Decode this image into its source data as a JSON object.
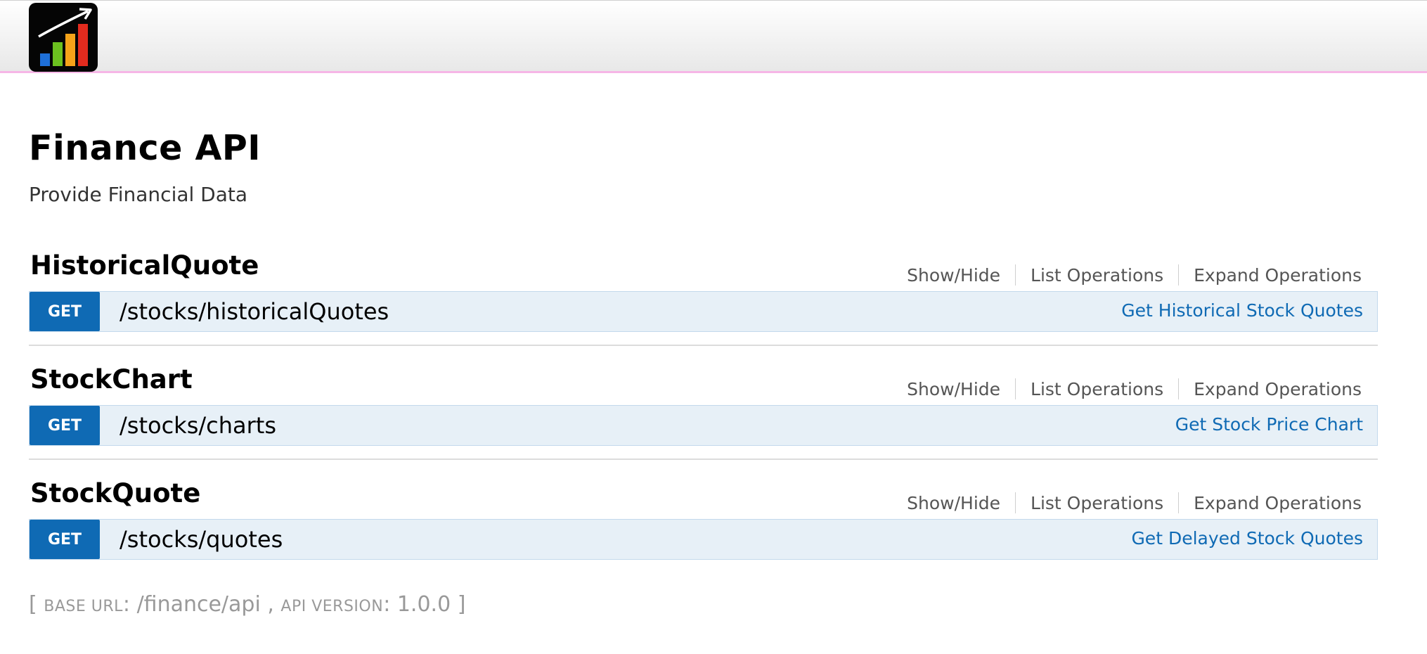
{
  "api": {
    "title": "Finance API",
    "description": "Provide Financial Data"
  },
  "sections": [
    {
      "name": "HistoricalQuote",
      "links": {
        "show_hide": "Show/Hide",
        "list_ops": "List Operations",
        "expand_ops": "Expand Operations"
      },
      "operation": {
        "method": "GET",
        "path": "/stocks/historicalQuotes",
        "summary": "Get Historical Stock Quotes"
      }
    },
    {
      "name": "StockChart",
      "links": {
        "show_hide": "Show/Hide",
        "list_ops": "List Operations",
        "expand_ops": "Expand Operations"
      },
      "operation": {
        "method": "GET",
        "path": "/stocks/charts",
        "summary": "Get Stock Price Chart"
      }
    },
    {
      "name": "StockQuote",
      "links": {
        "show_hide": "Show/Hide",
        "list_ops": "List Operations",
        "expand_ops": "Expand Operations"
      },
      "operation": {
        "method": "GET",
        "path": "/stocks/quotes",
        "summary": "Get Delayed Stock Quotes"
      }
    }
  ],
  "footer": {
    "open": "[ ",
    "base_url_label": "BASE URL",
    "colon1": ": ",
    "base_url": "/finance/api",
    "comma": " , ",
    "api_version_label": "API VERSION",
    "colon2": ": ",
    "api_version": "1.0.0",
    "close": " ]"
  },
  "colors": {
    "get_badge": "#0f6ab4",
    "op_background": "#e7f0f7",
    "link_blue": "#0f6ab4",
    "header_underline": "#f6b6e6"
  }
}
